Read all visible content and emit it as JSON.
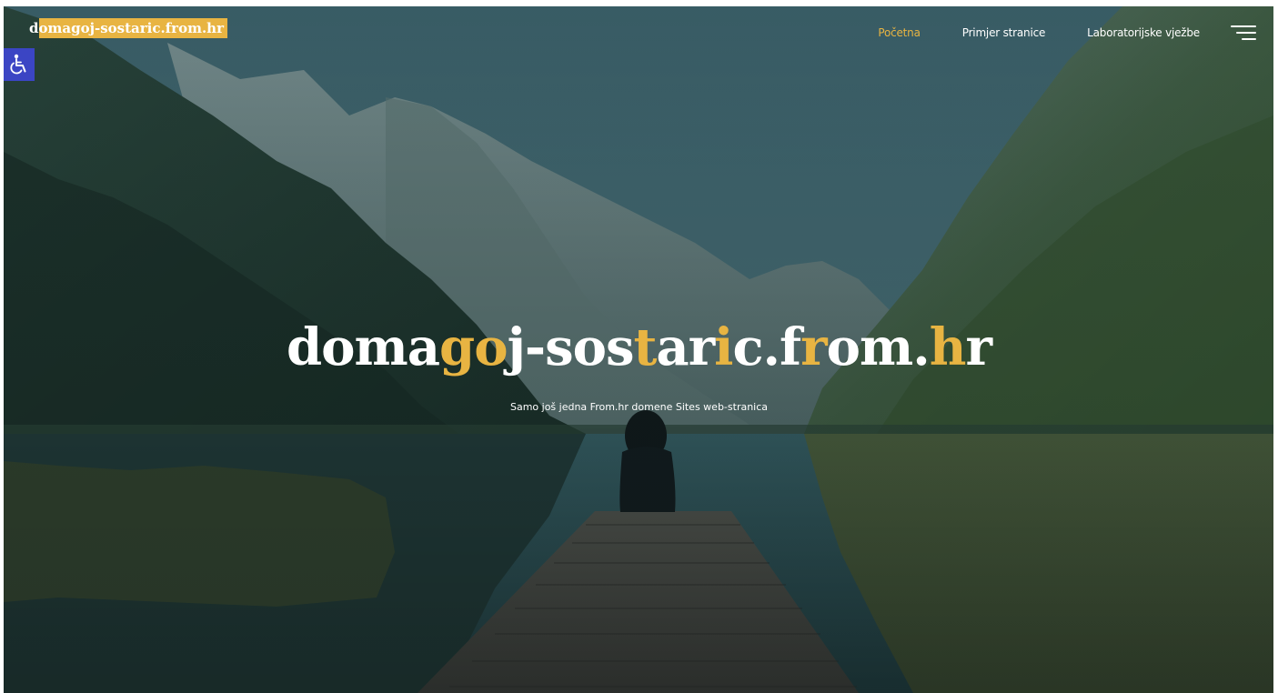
{
  "site": {
    "logo_text": "domagoj-sostaric.from.hr"
  },
  "nav": {
    "items": [
      {
        "label": "Početna",
        "active": true
      },
      {
        "label": "Primjer stranice",
        "active": false
      },
      {
        "label": "Laboratorijske vježbe",
        "active": false
      }
    ],
    "menu_icon": "hamburger-menu-icon"
  },
  "accessibility": {
    "icon": "wheelchair-icon"
  },
  "hero": {
    "title_segments": [
      {
        "text": "doma",
        "highlight": false
      },
      {
        "text": "go",
        "highlight": true
      },
      {
        "text": "j",
        "highlight": false
      },
      {
        "text": "-sos",
        "highlight": false
      },
      {
        "text": "t",
        "highlight": true
      },
      {
        "text": "ar",
        "highlight": false
      },
      {
        "text": "i",
        "highlight": true
      },
      {
        "text": "c.f",
        "highlight": false
      },
      {
        "text": "r",
        "highlight": true
      },
      {
        "text": "om.",
        "highlight": false
      },
      {
        "text": "h",
        "highlight": true
      },
      {
        "text": "r",
        "highlight": false
      }
    ],
    "subtitle": "Samo još jedna From.hr domene Sites web-stranica"
  },
  "colors": {
    "accent": "#e8b442",
    "text": "#ffffff",
    "accessibility_button": "#3b45c4"
  }
}
